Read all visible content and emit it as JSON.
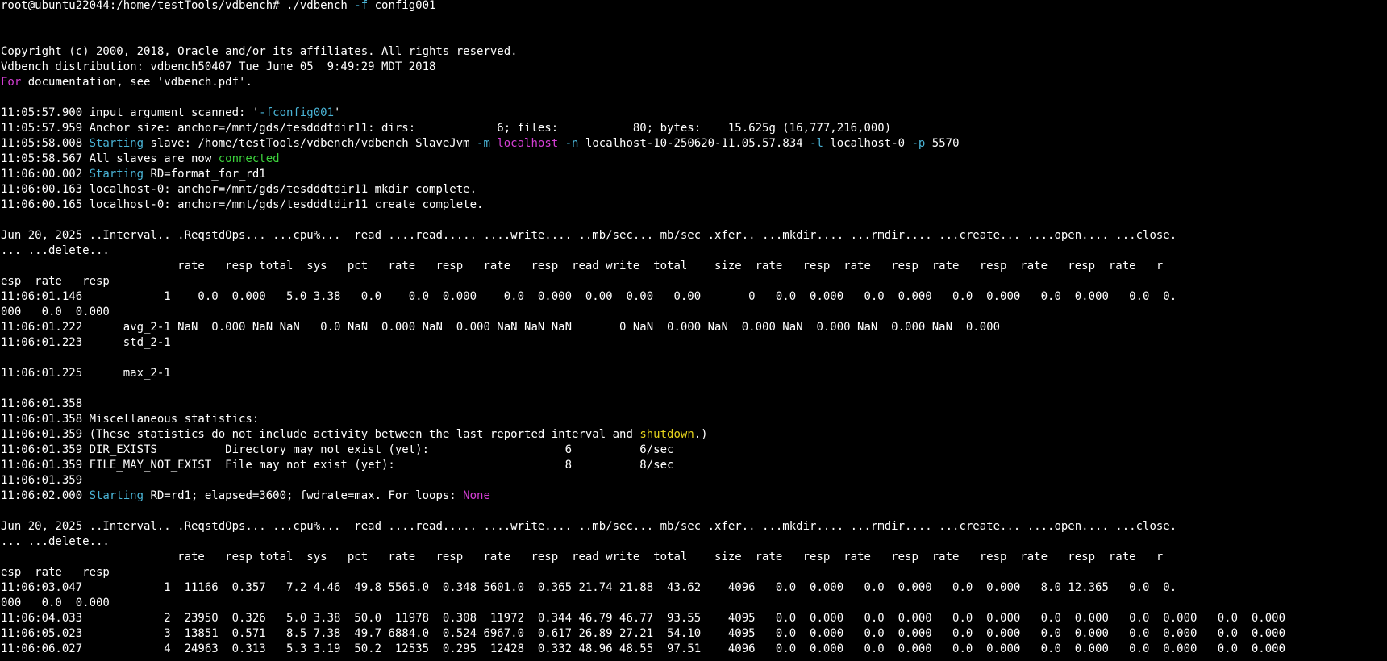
{
  "colors": {
    "background": "#000000",
    "foreground": "#ffffff",
    "cyan": "#4ab4d6",
    "magenta": "#d63fd6",
    "green": "#3cd33c",
    "yellow": "#e6d41c"
  },
  "terminal": {
    "lines": [
      [
        {
          "t": "root@ubuntu22044:/home/testTools/vdbench# ./vdbench "
        },
        {
          "t": "-f",
          "c": "cyan"
        },
        {
          "t": " config001"
        }
      ],
      [],
      [],
      [
        {
          "t": "Copyright (c) 2000, 2018, Oracle and/or its affiliates. All rights reserved."
        }
      ],
      [
        {
          "t": "Vdbench distribution: vdbench50407 Tue June 05  9:49:29 MDT 2018"
        }
      ],
      [
        {
          "t": "For",
          "c": "magenta"
        },
        {
          "t": " documentation, see 'vdbench.pdf'."
        }
      ],
      [],
      [
        {
          "t": "11:05:57.900 input argument scanned: '"
        },
        {
          "t": "-fconfig001",
          "c": "cyan"
        },
        {
          "t": "'"
        }
      ],
      [
        {
          "t": "11:05:57.959 Anchor size: anchor=/mnt/gds/tesdddtdir11: dirs:            6; files:           80; bytes:    15.625g (16,777,216,000)"
        }
      ],
      [
        {
          "t": "11:05:58.008 "
        },
        {
          "t": "Starting",
          "c": "cyan"
        },
        {
          "t": " slave: /home/testTools/vdbench/vdbench SlaveJvm "
        },
        {
          "t": "-m",
          "c": "cyan"
        },
        {
          "t": " "
        },
        {
          "t": "localhost",
          "c": "magenta"
        },
        {
          "t": " "
        },
        {
          "t": "-n",
          "c": "cyan"
        },
        {
          "t": " localhost-10-250620-11.05.57.834 "
        },
        {
          "t": "-l",
          "c": "cyan"
        },
        {
          "t": " localhost-0 "
        },
        {
          "t": "-p",
          "c": "cyan"
        },
        {
          "t": " 5570"
        }
      ],
      [
        {
          "t": "11:05:58.567 All slaves are now "
        },
        {
          "t": "connected",
          "c": "green"
        }
      ],
      [
        {
          "t": "11:06:00.002 "
        },
        {
          "t": "Starting",
          "c": "cyan"
        },
        {
          "t": " RD=format_for_rd1"
        }
      ],
      [
        {
          "t": "11:06:00.163 localhost-0: anchor=/mnt/gds/tesdddtdir11 mkdir complete."
        }
      ],
      [
        {
          "t": "11:06:00.165 localhost-0: anchor=/mnt/gds/tesdddtdir11 create complete."
        }
      ],
      [],
      [
        {
          "t": "Jun 20, 2025 ..Interval.. .ReqstdOps... ...cpu%...  read ....read..... ....write.... ..mb/sec... mb/sec .xfer.. ...mkdir.... ...rmdir.... ...create... ....open.... ...close."
        }
      ],
      [
        {
          "t": "... ...delete..."
        }
      ],
      [
        {
          "t": "                          rate   resp total  sys   pct   rate   resp   rate   resp  read write  total    size  rate   resp  rate   resp  rate   resp  rate   resp  rate   r"
        }
      ],
      [
        {
          "t": "esp  rate   resp"
        }
      ],
      [
        {
          "t": "11:06:01.146            1    0.0  0.000   5.0 3.38   0.0    0.0  0.000    0.0  0.000  0.00  0.00   0.00       0   0.0  0.000   0.0  0.000   0.0  0.000   0.0  0.000   0.0  0."
        }
      ],
      [
        {
          "t": "000   0.0  0.000"
        }
      ],
      [
        {
          "t": "11:06:01.222      avg_2-1 NaN  0.000 NaN NaN   0.0 NaN  0.000 NaN  0.000 NaN NaN NaN       0 NaN  0.000 NaN  0.000 NaN  0.000 NaN  0.000 NaN  0.000"
        }
      ],
      [
        {
          "t": "11:06:01.223      std_2-1"
        }
      ],
      [],
      [
        {
          "t": "11:06:01.225      max_2-1"
        }
      ],
      [],
      [
        {
          "t": "11:06:01.358"
        }
      ],
      [
        {
          "t": "11:06:01.358 Miscellaneous statistics:"
        }
      ],
      [
        {
          "t": "11:06:01.359 (These statistics do not include activity between the last reported interval and "
        },
        {
          "t": "shutdown",
          "c": "yellow"
        },
        {
          "t": ".)"
        }
      ],
      [
        {
          "t": "11:06:01.359 DIR_EXISTS          Directory may not exist (yet):                    6          6/sec"
        }
      ],
      [
        {
          "t": "11:06:01.359 FILE_MAY_NOT_EXIST  File may not exist (yet):                         8          8/sec"
        }
      ],
      [
        {
          "t": "11:06:01.359"
        }
      ],
      [
        {
          "t": "11:06:02.000 "
        },
        {
          "t": "Starting",
          "c": "cyan"
        },
        {
          "t": " RD=rd1; elapsed=3600; fwdrate=max. For loops: "
        },
        {
          "t": "None",
          "c": "magenta"
        }
      ],
      [],
      [
        {
          "t": "Jun 20, 2025 ..Interval.. .ReqstdOps... ...cpu%...  read ....read..... ....write.... ..mb/sec... mb/sec .xfer.. ...mkdir.... ...rmdir.... ...create... ....open.... ...close."
        }
      ],
      [
        {
          "t": "... ...delete..."
        }
      ],
      [
        {
          "t": "                          rate   resp total  sys   pct   rate   resp   rate   resp  read write  total    size  rate   resp  rate   resp  rate   resp  rate   resp  rate   r"
        }
      ],
      [
        {
          "t": "esp  rate   resp"
        }
      ],
      [
        {
          "t": "11:06:03.047            1  11166  0.357   7.2 4.46  49.8 5565.0  0.348 5601.0  0.365 21.74 21.88  43.62    4096   0.0  0.000   0.0  0.000   0.0  0.000   8.0 12.365   0.0  0."
        }
      ],
      [
        {
          "t": "000   0.0  0.000"
        }
      ],
      [
        {
          "t": "11:06:04.033            2  23950  0.326   5.0 3.38  50.0  11978  0.308  11972  0.344 46.79 46.77  93.55    4095   0.0  0.000   0.0  0.000   0.0  0.000   0.0  0.000   0.0  0.000   0.0  0.000"
        }
      ],
      [
        {
          "t": "11:06:05.023            3  13851  0.571   8.5 7.38  49.7 6884.0  0.524 6967.0  0.617 26.89 27.21  54.10    4095   0.0  0.000   0.0  0.000   0.0  0.000   0.0  0.000   0.0  0.000   0.0  0.000"
        }
      ],
      [
        {
          "t": "11:06:06.027            4  24963  0.313   5.3 3.19  50.2  12535  0.295  12428  0.332 48.96 48.55  97.51    4096   0.0  0.000   0.0  0.000   0.0  0.000   0.0  0.000   0.0  0.000   0.0  0.000"
        }
      ]
    ]
  }
}
